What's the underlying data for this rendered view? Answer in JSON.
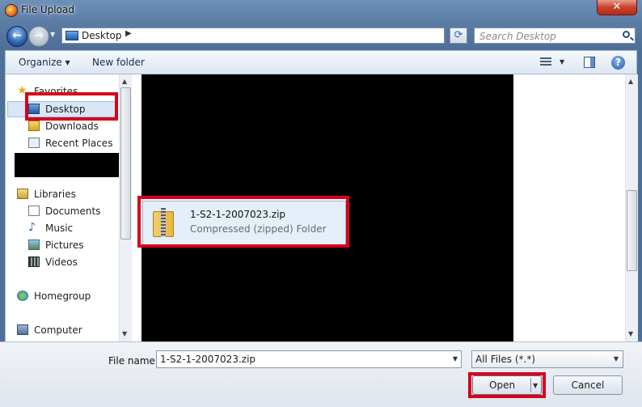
{
  "window": {
    "title": "File Upload",
    "close_glyph": "✕"
  },
  "navigation": {
    "back_glyph": "←",
    "forward_glyph": "→",
    "address_path": "Desktop",
    "refresh_glyph": "⟳",
    "search_placeholder": "Search Desktop"
  },
  "toolbar": {
    "organize_label": "Organize ▾",
    "new_folder_label": "New folder",
    "help_label": "?"
  },
  "sidebar": {
    "favorites_label": "Favorites",
    "favorites": [
      "Desktop",
      "Downloads",
      "Recent Places"
    ],
    "libraries_label": "Libraries",
    "libraries": [
      "Documents",
      "Music",
      "Pictures",
      "Videos"
    ],
    "homegroup_label": "Homegroup",
    "computer_label": "Computer",
    "selected": "Desktop"
  },
  "files": [
    {
      "name": "1-S2-1-2007023.zip",
      "type": "Compressed (zipped) Folder",
      "selected": true
    }
  ],
  "footer": {
    "file_name_label": "File name:",
    "file_name_value": "1-S2-1-2007023.zip",
    "file_type_value": "All Files (*.*)",
    "open_label": "Open",
    "cancel_label": "Cancel"
  },
  "colors": {
    "annotation_red": "#d8001b",
    "selection_blue": "#e5effa"
  }
}
